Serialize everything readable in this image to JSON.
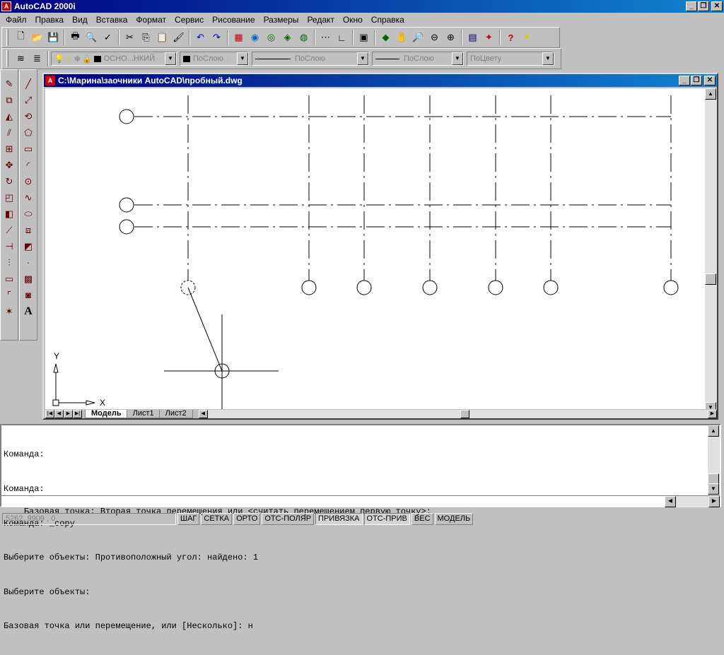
{
  "app": {
    "title": "AutoCAD 2000i",
    "title_icon": "autocad-logo-icon",
    "min": "_",
    "max": "❐",
    "close": "✕"
  },
  "menu": [
    "Файл",
    "Правка",
    "Вид",
    "Вставка",
    "Формат",
    "Сервис",
    "Рисование",
    "Размеры",
    "Редакт",
    "Окно",
    "Справка"
  ],
  "toolbar_standard": [
    "new-icon",
    "open-icon",
    "save-icon",
    "print-icon",
    "preview-icon",
    "spell-icon",
    "cut-icon",
    "copy-icon",
    "paste-icon",
    "matchprop-icon",
    "undo-icon",
    "redo-icon",
    "hyperlink-icon",
    "today-icon",
    "browser-icon",
    "design-center-icon",
    "layers-icon",
    "tracking-icon",
    "ucs-icon",
    "named-views-icon",
    "pan-icon",
    "zoom-realtime-icon",
    "zoom-window-icon",
    "zoom-prev-icon",
    "properties-icon",
    "adcenter-icon",
    "help-icon",
    "tips-icon"
  ],
  "layer_bar": {
    "layer_name": "ОСНО...НКИЙ",
    "color": "ПоСлою",
    "linetype": "ПоСлою",
    "lineweight": "ПоСлою",
    "plotstyle": "ПоЦвету"
  },
  "draw_tools": [
    "erase",
    "copy",
    "mirror",
    "offset",
    "array",
    "move",
    "rotate",
    "scale",
    "stretch",
    "trim",
    "extend",
    "break",
    "chamfer",
    "fillet",
    "explode"
  ],
  "draw_tools2": [
    "line",
    "xline",
    "pline",
    "polygon",
    "rectangle",
    "arc",
    "circle",
    "spline",
    "ellipse",
    "insert",
    "block",
    "point",
    "hatch",
    "region",
    "mtext"
  ],
  "document": {
    "title": "C:\\Марина\\заочники AutoCAD\\пробный.dwg",
    "tabs": [
      "Модель",
      "Лист1",
      "Лист2"
    ],
    "ucs_x": "X",
    "ucs_y": "Y"
  },
  "command_history": [
    "Команда:",
    "Команда:",
    "Команда: _copy",
    "Выберите объекты: Противоположный угол: найдено: 1",
    "Выберите объекты:",
    "Базовая точка или перемещение, или [Несколько]: н"
  ],
  "command_prompt": "Базовая точка: Вторая точка перемещения или <считать перемещением первую точку>:",
  "status": {
    "coords": "5262, 9909 , 0",
    "buttons": [
      {
        "label": "ШАГ",
        "on": false
      },
      {
        "label": "СЕТКА",
        "on": false
      },
      {
        "label": "ОРТО",
        "on": false
      },
      {
        "label": "ОТС-ПОЛЯР",
        "on": false
      },
      {
        "label": "ПРИВЯЗКА",
        "on": true
      },
      {
        "label": "ОТС-ПРИВ",
        "on": true
      },
      {
        "label": "ВЕС",
        "on": false
      },
      {
        "label": "МОДЕЛЬ",
        "on": false
      }
    ]
  }
}
